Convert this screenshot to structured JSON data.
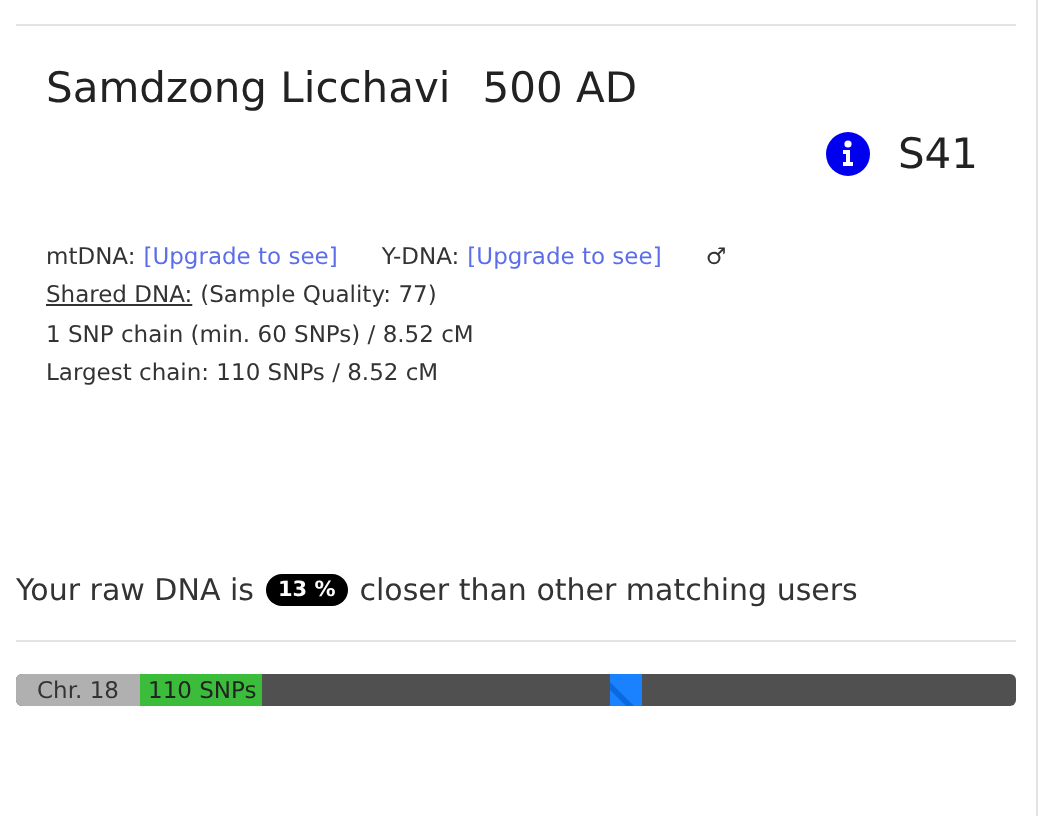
{
  "title": {
    "name": "Samdzong Licchavi",
    "date": "500 AD"
  },
  "sample_id": "S41",
  "info": {
    "mtdna_label": "mtDNA:",
    "mtdna_value": "[Upgrade to see]",
    "ydna_label": "Y-DNA:",
    "ydna_value": "[Upgrade to see]",
    "sex_symbol": "♂",
    "shared_label": "Shared DNA:",
    "quality": "(Sample Quality: 77)",
    "lines": [
      "1 SNP chain (min. 60 SNPs) / 8.52 cM",
      "Largest chain: 110 SNPs / 8.52 cM"
    ]
  },
  "comparison": {
    "before": "Your raw DNA is",
    "badge": "13 %",
    "after": "closer than other matching users"
  },
  "chromosome": {
    "label": "Chr. 18",
    "snps": "110 SNPs"
  }
}
